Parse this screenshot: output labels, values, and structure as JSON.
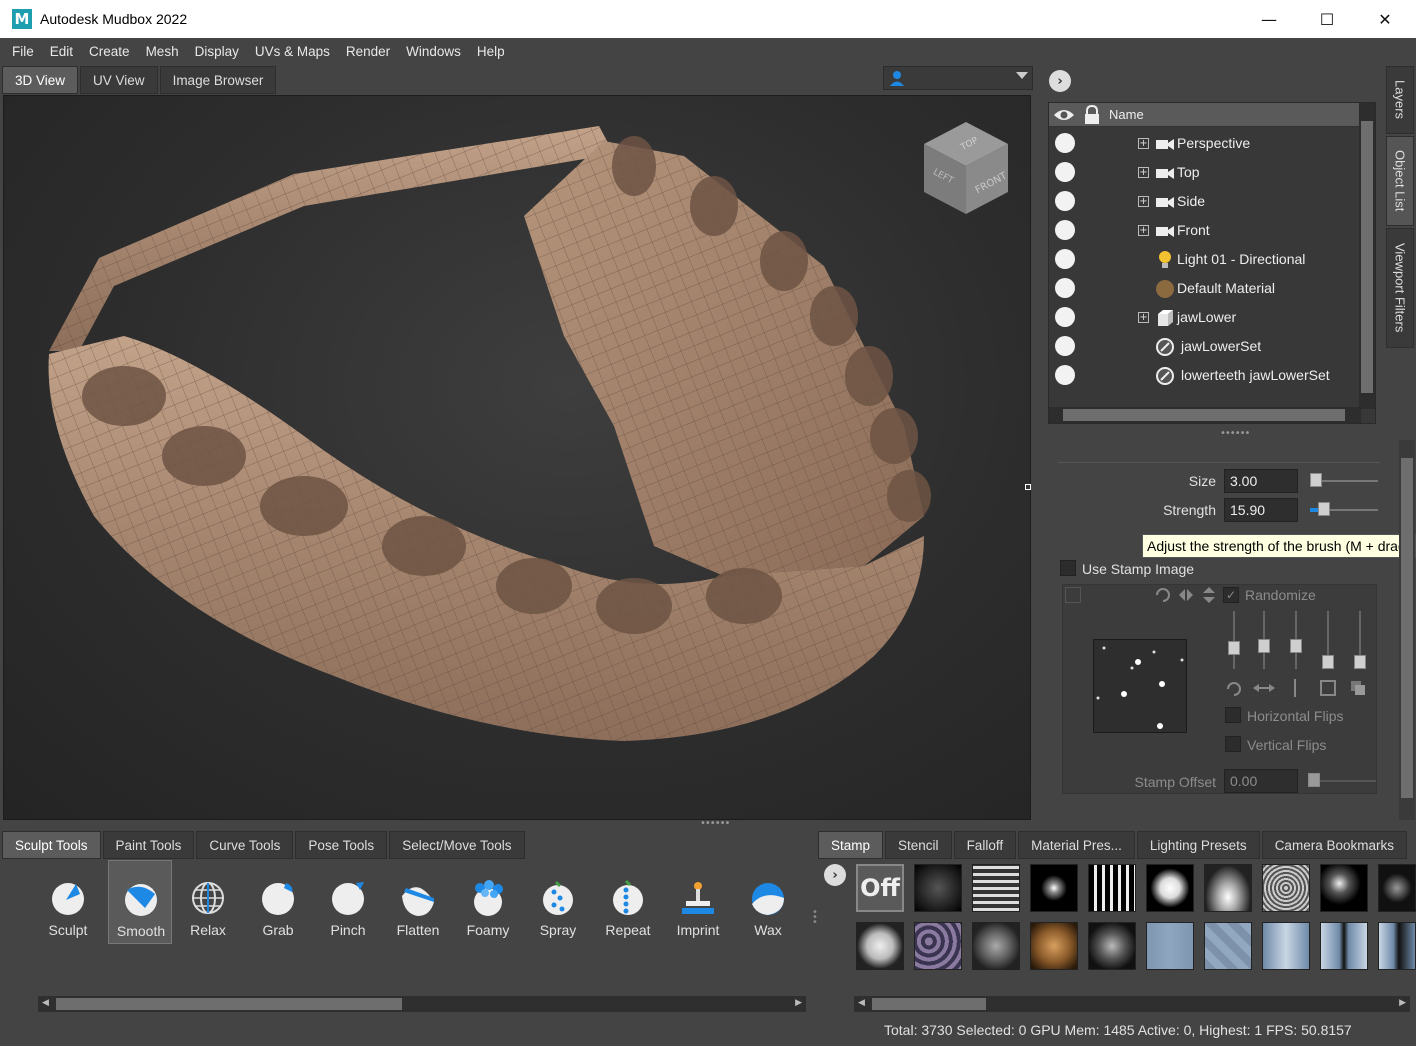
{
  "window": {
    "title": "Autodesk Mudbox 2022",
    "logo": "M",
    "minimize": "—",
    "maximize": "☐",
    "close": "✕"
  },
  "menu": [
    "File",
    "Edit",
    "Create",
    "Mesh",
    "Display",
    "UVs & Maps",
    "Render",
    "Windows",
    "Help"
  ],
  "view_tabs": [
    "3D View",
    "UV View",
    "Image Browser"
  ],
  "viewcube": {
    "top": "TOP",
    "left": "LEFT",
    "front": "FRONT"
  },
  "side_tabs": [
    "Layers",
    "Object List",
    "Viewport Filters"
  ],
  "object_list": {
    "header": "Name",
    "rows": [
      {
        "label": "Perspective",
        "icon": "camera-icon"
      },
      {
        "label": "Top",
        "icon": "camera-icon"
      },
      {
        "label": "Side",
        "icon": "camera-icon"
      },
      {
        "label": "Front",
        "icon": "camera-icon"
      },
      {
        "label": "Light 01 - Directional",
        "icon": "light-bulb-icon"
      },
      {
        "label": "Default Material",
        "icon": "material-sphere-icon"
      },
      {
        "label": "jawLower",
        "icon": "mesh-cube-icon"
      },
      {
        "label": "jawLowerSet",
        "icon": "selection-set-icon"
      },
      {
        "label": "lowerteeth jawLowerSet",
        "icon": "selection-set-icon"
      }
    ]
  },
  "properties": {
    "size_label": "Size",
    "size_value": "3.00",
    "size_fraction": 0.02,
    "strength_label": "Strength",
    "strength_value": "15.90",
    "strength_fraction": 0.16,
    "tooltip": "Adjust the strength of the brush (M + drag, o",
    "use_stamp_label": "Use Stamp Image",
    "randomize_label": "Randomize",
    "horizontal_flips_label": "Horizontal Flips",
    "vertical_flips_label": "Vertical Flips",
    "stamp_offset_label": "Stamp Offset",
    "stamp_offset_value": "0.00"
  },
  "tool_tabs": [
    "Sculpt Tools",
    "Paint Tools",
    "Curve Tools",
    "Pose Tools",
    "Select/Move Tools"
  ],
  "tools": [
    "Sculpt",
    "Smooth",
    "Relax",
    "Grab",
    "Pinch",
    "Flatten",
    "Foamy",
    "Spray",
    "Repeat",
    "Imprint",
    "Wax"
  ],
  "selected_tool": "Smooth",
  "stamp_tabs": [
    "Stamp",
    "Stencil",
    "Falloff",
    "Material Pres...",
    "Lighting Presets",
    "Camera Bookmarks"
  ],
  "stamp_off_label": "Off",
  "status": "Total: 3730  Selected: 0 GPU Mem: 1485  Active: 0, Highest:  1  FPS: 50.8157",
  "colors": {
    "mesh": "#a5856e",
    "viewport_bg": "#2d2d2d",
    "ui_bg": "#444444",
    "accent_blue": "#1e88e5"
  }
}
